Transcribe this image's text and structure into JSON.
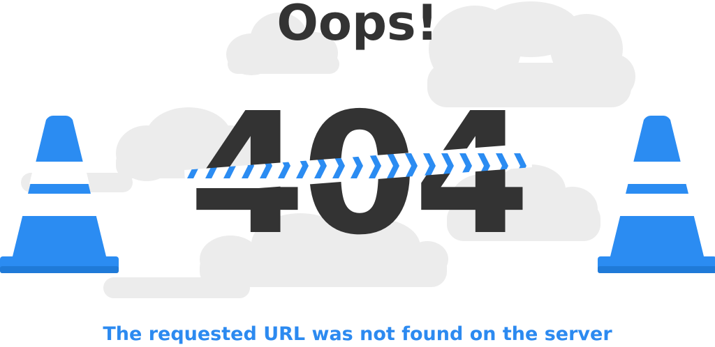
{
  "page": {
    "headline": "Oops!",
    "status_code": "404",
    "message": "The requested URL was not found on the server"
  },
  "colors": {
    "text_dark": "#333333",
    "accent_blue": "#2c8af0",
    "cone_blue": "#2b8cf2",
    "cloud_gray": "#ececec"
  },
  "icons": [
    "traffic-cone-icon",
    "traffic-cone-icon",
    "caution-tape-icon",
    "cloud-icon"
  ]
}
